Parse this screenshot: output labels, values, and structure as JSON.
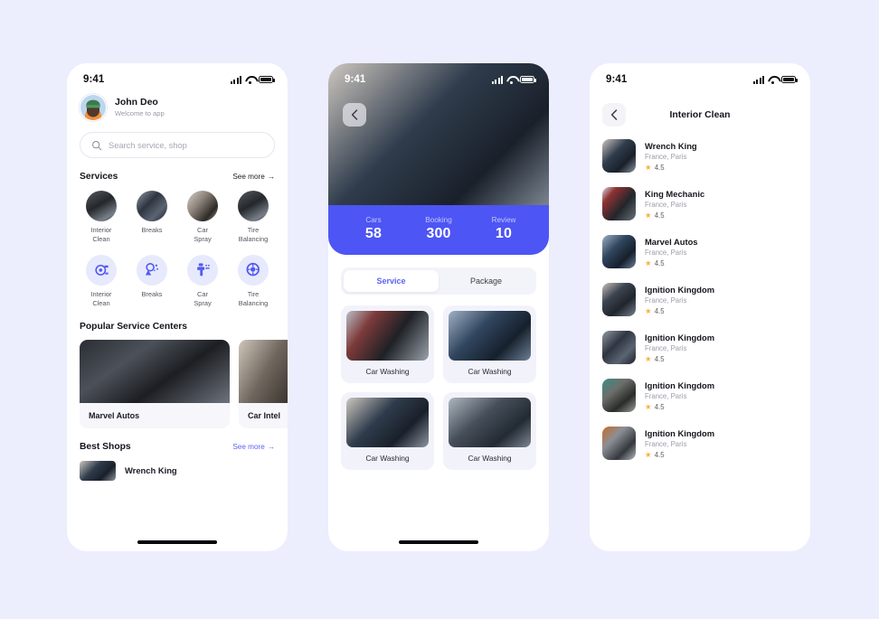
{
  "app": {
    "bg_color": "#ecedfd",
    "accent": "#4d55f4",
    "star_color": "#fbb040"
  },
  "status_bar": {
    "time": "9:41"
  },
  "home": {
    "profile": {
      "name": "John Deo",
      "subtitle": "Welcome to app"
    },
    "search": {
      "placeholder": "Search service, shop",
      "icon": "search-icon"
    },
    "services_section": {
      "title": "Services",
      "see_more": "See more",
      "photo_services": [
        {
          "label": "Interior\nClean",
          "label_line1": "Interior",
          "label_line2": "Clean"
        },
        {
          "label": "Breaks",
          "label_line1": "Breaks",
          "label_line2": ""
        },
        {
          "label": "Car Spray",
          "label_line1": "Car",
          "label_line2": "Spray"
        },
        {
          "label": "Tire Balancing",
          "label_line1": "Tire",
          "label_line2": "Balancing"
        }
      ],
      "icon_services": [
        {
          "label_line1": "Interior",
          "label_line2": "Clean",
          "icon": "turbo-fan-icon"
        },
        {
          "label_line1": "Breaks",
          "label_line2": "",
          "icon": "spray-gun-icon"
        },
        {
          "label_line1": "Car",
          "label_line2": "Spray",
          "icon": "paint-sprayer-icon"
        },
        {
          "label_line1": "Tire",
          "label_line2": "Balancing",
          "icon": "tire-wheel-icon"
        }
      ]
    },
    "popular_section": {
      "title": "Popular Service Centers",
      "cards": [
        {
          "name": "Marvel Autos"
        },
        {
          "name": "Car Intel"
        }
      ]
    },
    "best_shops_section": {
      "title": "Best Shops",
      "see_more": "See more",
      "shops": [
        {
          "name": "Wrench King"
        }
      ]
    }
  },
  "detail": {
    "back_icon": "chevron-left-icon",
    "stats": [
      {
        "label": "Cars",
        "value": "58"
      },
      {
        "label": "Booking",
        "value": "300"
      },
      {
        "label": "Review",
        "value": "10"
      }
    ],
    "tabs": [
      {
        "label": "Service",
        "active": true
      },
      {
        "label": "Package",
        "active": false
      }
    ],
    "service_cards": [
      {
        "label": "Car Washing"
      },
      {
        "label": "Car Washing"
      },
      {
        "label": "Car Washing"
      },
      {
        "label": "Car Washing"
      }
    ]
  },
  "list": {
    "title": "Interior Clean",
    "back_icon": "chevron-left-icon",
    "items": [
      {
        "name": "Wrench King",
        "location": "France, Paris",
        "rating": "4.5"
      },
      {
        "name": "King Mechanic",
        "location": "France, Paris",
        "rating": "4.5"
      },
      {
        "name": "Marvel Autos",
        "location": "France, Paris",
        "rating": "4.5"
      },
      {
        "name": "Ignition Kingdom",
        "location": "France, Paris",
        "rating": "4.5"
      },
      {
        "name": "Ignition Kingdom",
        "location": "France, Paris",
        "rating": "4.5"
      },
      {
        "name": "Ignition Kingdom",
        "location": "France, Paris",
        "rating": "4.5"
      },
      {
        "name": "Ignition Kingdom",
        "location": "France, Paris",
        "rating": "4.5"
      }
    ]
  }
}
